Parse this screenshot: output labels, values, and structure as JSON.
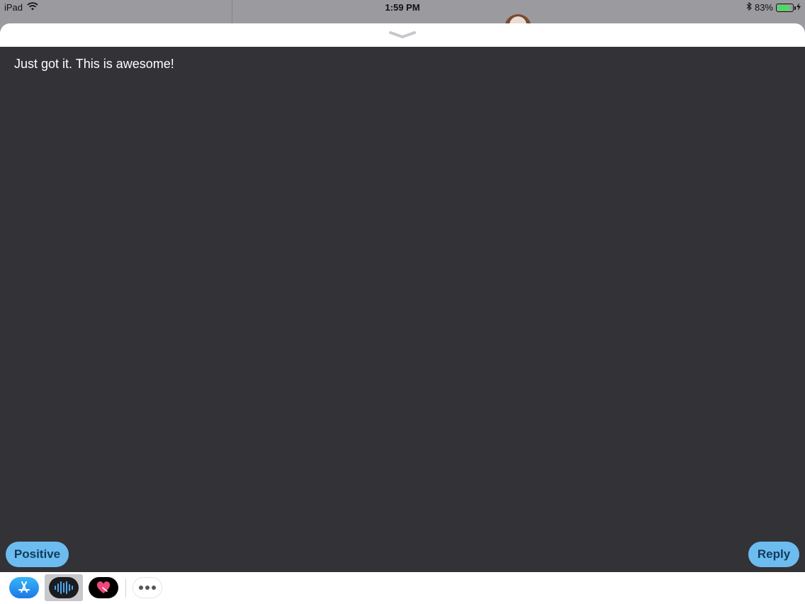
{
  "status_bar": {
    "device": "iPad",
    "time": "1:59 PM",
    "battery_percent": "83%",
    "battery_level": 0.83
  },
  "message": {
    "text": "Just got it. This is awesome!"
  },
  "buttons": {
    "positive_label": "Positive",
    "reply_label": "Reply"
  },
  "app_drawer": {
    "items": [
      {
        "name": "app-store",
        "icon": "app-store-icon",
        "selected": false
      },
      {
        "name": "waveform-app",
        "icon": "waveform-icon",
        "selected": true
      },
      {
        "name": "digital-touch",
        "icon": "heart-icon",
        "selected": false
      },
      {
        "name": "more",
        "icon": "more-icon",
        "selected": false
      }
    ]
  },
  "colors": {
    "content_bg": "#333236",
    "pill_bg": "#6cbcf0",
    "pill_text": "#123a5a",
    "battery_fill": "#4cd964"
  }
}
